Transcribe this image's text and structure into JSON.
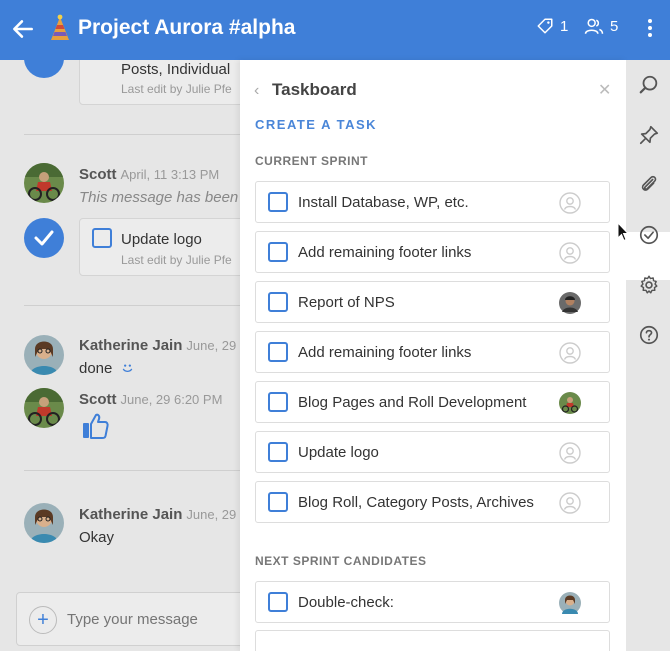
{
  "header": {
    "title": "Project Aurora #alpha",
    "tag_count": "1",
    "user_count": "5"
  },
  "chat": {
    "card1": {
      "title": "Posts, Individual",
      "subtitle": "Last edit by Julie Pfe"
    },
    "msg1": {
      "author": "Scott",
      "time": "April, 11 3:13 PM",
      "text": "This message has been"
    },
    "card2": {
      "title": "Update logo",
      "subtitle": "Last edit by Julie Pfe"
    },
    "msg2": {
      "author": "Katherine Jain",
      "time": "June, 29",
      "text": "done"
    },
    "msg3": {
      "author": "Scott",
      "time": "June, 29 6:20 PM"
    },
    "msg4": {
      "author": "Katherine Jain",
      "time": "June, 29",
      "text": "Okay"
    },
    "compose_placeholder": "Type your message"
  },
  "taskboard": {
    "title": "Taskboard",
    "create_label": "CREATE A TASK",
    "current_heading": "CURRENT SPRINT",
    "next_heading": "NEXT SPRINT CANDIDATES",
    "current_tasks": [
      {
        "label": "Install Database, WP, etc.",
        "assignee": "none"
      },
      {
        "label": "Add remaining footer links",
        "assignee": "none"
      },
      {
        "label": "Report of NPS",
        "assignee": "user-dark"
      },
      {
        "label": "Add remaining footer links",
        "assignee": "none"
      },
      {
        "label": "Blog Pages and Roll Development",
        "assignee": "user-bike"
      },
      {
        "label": "Update logo",
        "assignee": "none"
      },
      {
        "label": "Blog Roll, Category Posts, Archives",
        "assignee": "none"
      }
    ],
    "next_tasks": [
      {
        "label": "Double-check:",
        "assignee": "user-katherine"
      }
    ]
  },
  "colors": {
    "accent": "#3f7fd8",
    "header_bg": "#3f7fd8",
    "chat_bg": "#e6e6e6"
  },
  "icons": {
    "header": [
      "back-arrow-icon",
      "party-hat-logo-icon",
      "tag-icon",
      "users-icon",
      "more-vertical-icon"
    ],
    "rail": [
      "search-icon",
      "pin-icon",
      "paperclip-icon",
      "check-circle-icon",
      "gear-icon",
      "help-icon"
    ]
  }
}
